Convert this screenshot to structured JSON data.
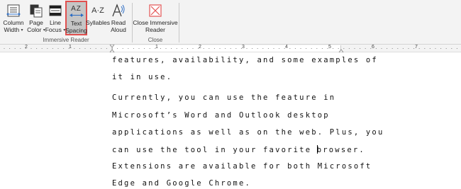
{
  "ribbon": {
    "buttons": [
      {
        "id": "column-width",
        "line1": "Column",
        "line2": "Width",
        "has_dropdown": true
      },
      {
        "id": "page-color",
        "line1": "Page",
        "line2": "Color",
        "has_dropdown": true
      },
      {
        "id": "line-focus",
        "line1": "Line",
        "line2": "Focus",
        "has_dropdown": true
      },
      {
        "id": "text-spacing",
        "line1": "Text",
        "line2": "Spacing",
        "active": true
      },
      {
        "id": "syllables",
        "line1": "Syllables",
        "line2": ""
      },
      {
        "id": "read-aloud",
        "line1": "Read",
        "line2": "Aloud"
      },
      {
        "id": "close-immersive-reader",
        "line1": "Close Immersive",
        "line2": "Reader"
      }
    ],
    "icons": {
      "text_spacing": "AZ",
      "syllables": "A·Z"
    },
    "groups": [
      {
        "label": "Immersive Reader"
      },
      {
        "label": "Close"
      }
    ]
  },
  "ruler": {
    "numbers_left": [
      "2",
      "1"
    ],
    "numbers_right": [
      "1",
      "2",
      "3",
      "4",
      "5",
      "6",
      "7"
    ]
  },
  "document": {
    "lines": [
      "features, availability, and some examples of",
      "it in use.",
      "Currently, you can use the feature in",
      "Microsoft’s Word and Outlook desktop",
      "applications as well as on the web. Plus, you",
      "Extensions are available for both Microsoft",
      "Edge and Google Chrome."
    ],
    "cursor_line_before": "can use the tool in your favorite ",
    "cursor_line_after": "browser."
  },
  "colors": {
    "active_outline": "#e0504f",
    "ribbon_bg": "#f3f3f3",
    "icon_blue": "#2b6cc4",
    "close_red": "#e35454"
  }
}
